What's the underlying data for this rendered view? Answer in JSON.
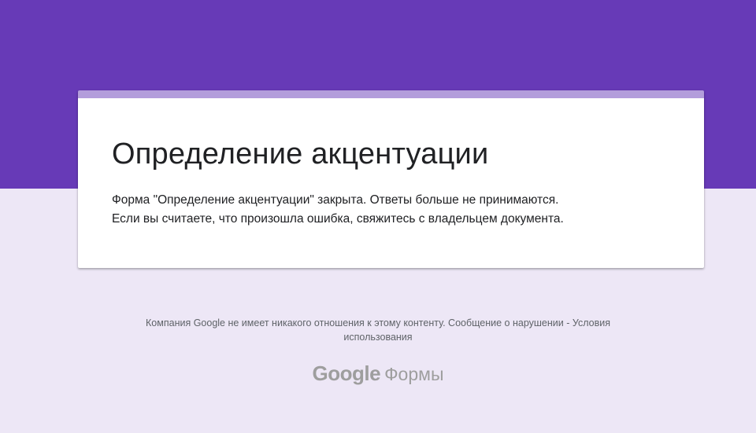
{
  "form": {
    "title": "Определение акцентуации",
    "message_line_1": "Форма \"Определение акцентуации\" закрыта. Ответы больше не принимаются.",
    "message_line_2": "Если вы считаете, что произошла ошибка, свяжитесь с владельцем документа."
  },
  "footer": {
    "disclaimer": "Компания Google не имеет никакого отношения к этому контенту.",
    "report_link": "Сообщение о нарушении",
    "separator": " - ",
    "terms_link_part1": "Условия",
    "terms_link_part2": "использования"
  },
  "logo": {
    "brand": "Google",
    "product": "Формы"
  },
  "colors": {
    "header_band": "#673ab7",
    "card_accent": "#b39ddb",
    "page_background": "#ede7f6"
  }
}
